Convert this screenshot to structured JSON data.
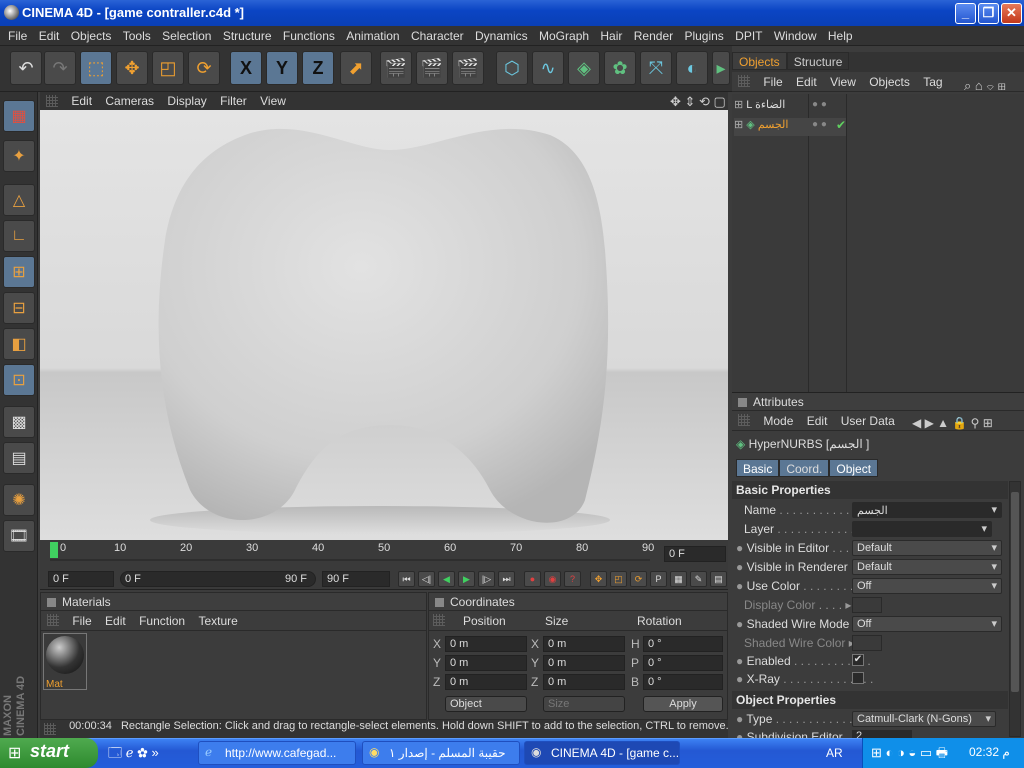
{
  "window": {
    "title": "CINEMA 4D - [game contraller.c4d *]"
  },
  "menubar": [
    "File",
    "Edit",
    "Objects",
    "Tools",
    "Selection",
    "Structure",
    "Functions",
    "Animation",
    "Character",
    "Dynamics",
    "MoGraph",
    "Hair",
    "Render",
    "Plugins",
    "DPIT",
    "Window",
    "Help"
  ],
  "toolbar": {
    "axis_x": "X",
    "axis_y": "Y",
    "axis_z": "Z"
  },
  "viewport": {
    "menu": [
      "Edit",
      "Cameras",
      "Display",
      "Filter",
      "View"
    ]
  },
  "timeline": {
    "ticks": [
      "0",
      "10",
      "20",
      "30",
      "40",
      "50",
      "60",
      "70",
      "80",
      "90"
    ],
    "current_frame": "0 F"
  },
  "transport": {
    "start": "0 F",
    "range_start": "0 F",
    "range_end": "90 F",
    "end": "90 F"
  },
  "materials": {
    "title": "Materials",
    "menu": [
      "File",
      "Edit",
      "Function",
      "Texture"
    ],
    "item": "Mat"
  },
  "coordinates": {
    "title": "Coordinates",
    "headers": [
      "Position",
      "Size",
      "Rotation"
    ],
    "rows": [
      {
        "a": "X",
        "pos": "0 m",
        "b": "X",
        "size": "0 m",
        "c": "H",
        "rot": "0 °"
      },
      {
        "a": "Y",
        "pos": "0 m",
        "b": "Y",
        "size": "0 m",
        "c": "P",
        "rot": "0 °"
      },
      {
        "a": "Z",
        "pos": "0 m",
        "b": "Z",
        "size": "0 m",
        "c": "B",
        "rot": "0 °"
      }
    ],
    "mode": "Object",
    "size_mode": "Size",
    "apply": "Apply"
  },
  "status": {
    "time": "00:00:34",
    "text": "Rectangle Selection: Click and drag to rectangle-select elements. Hold down SHIFT to add to the selection, CTRL to remove."
  },
  "objects": {
    "tabs": [
      "Objects",
      "Structure"
    ],
    "menu": [
      "File",
      "Edit",
      "View",
      "Objects",
      "Tag"
    ],
    "items": [
      {
        "name": "الضاءة"
      },
      {
        "name": "الجسم"
      }
    ]
  },
  "attributes": {
    "title": "Attributes",
    "menu": [
      "Mode",
      "Edit",
      "User Data"
    ],
    "object_label": "HyperNURBS [الجسم ]",
    "tabs": [
      "Basic",
      "Coord.",
      "Object"
    ],
    "basic_title": "Basic Properties",
    "name_label": "Name",
    "name_value": "الجسم",
    "layer_label": "Layer",
    "vis_editor_label": "Visible in Editor",
    "vis_editor_value": "Default",
    "vis_render_label": "Visible in Renderer",
    "vis_render_value": "Default",
    "use_color_label": "Use Color",
    "use_color_value": "Off",
    "display_color_label": "Display Color",
    "shaded_wire_label": "Shaded Wire Mode",
    "shaded_wire_value": "Off",
    "shaded_wire_color_label": "Shaded Wire Color",
    "enabled_label": "Enabled",
    "xray_label": "X-Ray",
    "object_title": "Object Properties",
    "type_label": "Type",
    "type_value": "Catmull-Clark (N-Gons)",
    "subdiv_label": "Subdivision Editor",
    "subdiv_value": "2"
  },
  "taskbar": {
    "start": "start",
    "tasks": [
      "http://www.cafegad...",
      "حقيبة المسلم - إصدار ١",
      "CINEMA 4D - [game c..."
    ],
    "lang": "AR",
    "clock": "02:32 م"
  }
}
